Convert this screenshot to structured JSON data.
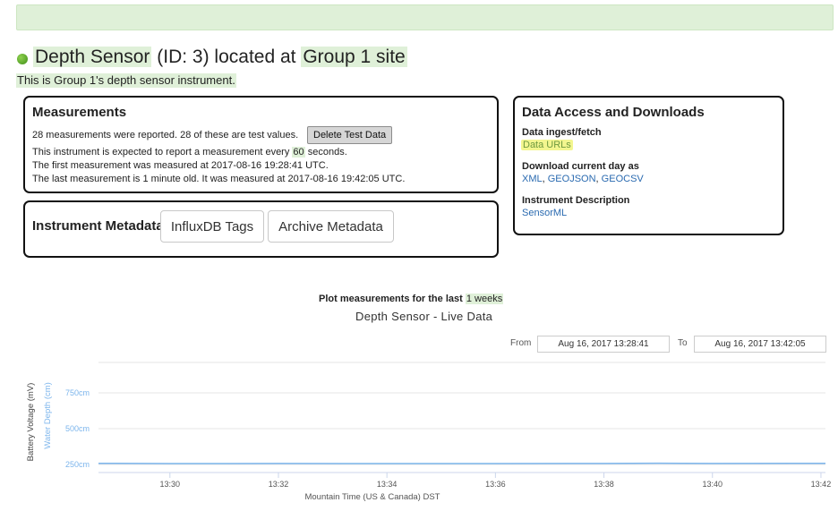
{
  "header": {
    "sensor_name": "Depth Sensor",
    "id_text": "(ID: 3) located at",
    "site_name": "Group 1 site",
    "description": "This is Group 1's depth sensor instrument.",
    "status_color": "#4ea52a"
  },
  "measurements": {
    "title": "Measurements",
    "line1": "28 measurements were reported. 28 of these are test values.",
    "delete_button": "Delete Test Data",
    "line2_pre": "This instrument is expected to report a measurement every",
    "interval": "60",
    "line2_post": "seconds.",
    "line3": "The first measurement was measured at 2017-08-16 19:28:41 UTC.",
    "line4": "The last measurement is 1 minute old. It was measured at 2017-08-16 19:42:05 UTC."
  },
  "metadata": {
    "title": "Instrument Metadata",
    "influx_button": "InfluxDB Tags",
    "archive_button": "Archive Metadata"
  },
  "data_access": {
    "title": "Data Access and Downloads",
    "ingest_label": "Data ingest/fetch",
    "ingest_link": "Data URLs",
    "download_label": "Download current day as",
    "formats": [
      "XML",
      "GEOJSON",
      "GEOCSV"
    ],
    "description_label": "Instrument Description",
    "description_link": "SensorML"
  },
  "plot": {
    "heading_pre": "Plot measurements for the last",
    "period_value": "1",
    "period_unit": "weeks",
    "range_from_label": "From",
    "range_from": "Aug 16, 2017 13:28:41",
    "range_to_label": "To",
    "range_to": "Aug 16, 2017 13:42:05"
  },
  "chart_data": {
    "type": "line",
    "title": "Depth Sensor - Live Data",
    "xlabel": "Mountain Time (US & Canada) DST",
    "ylabel_left": "Battery Voltage (mV)",
    "ylabel_right": "Water Depth (cm)",
    "x_ticks": [
      "13:30",
      "13:32",
      "13:34",
      "13:36",
      "13:38",
      "13:40",
      "13:42"
    ],
    "y_ticks": [
      "750cm",
      "500cm",
      "250cm"
    ],
    "y_tick_values": [
      750,
      500,
      250
    ],
    "ylim": [
      200,
      1000
    ],
    "xlim": [
      "13:28:41",
      "13:42:05"
    ],
    "grid": true,
    "series_color": "#7cb5ec",
    "series": [
      {
        "name": "Water Depth (cm)",
        "x": [
          "13:28:41",
          "13:30:00",
          "13:32:00",
          "13:34:00",
          "13:36:00",
          "13:38:00",
          "13:39:00",
          "13:40:00",
          "13:42:05"
        ],
        "values": [
          258,
          256,
          257,
          256,
          256,
          257,
          259,
          257,
          258
        ]
      }
    ]
  }
}
